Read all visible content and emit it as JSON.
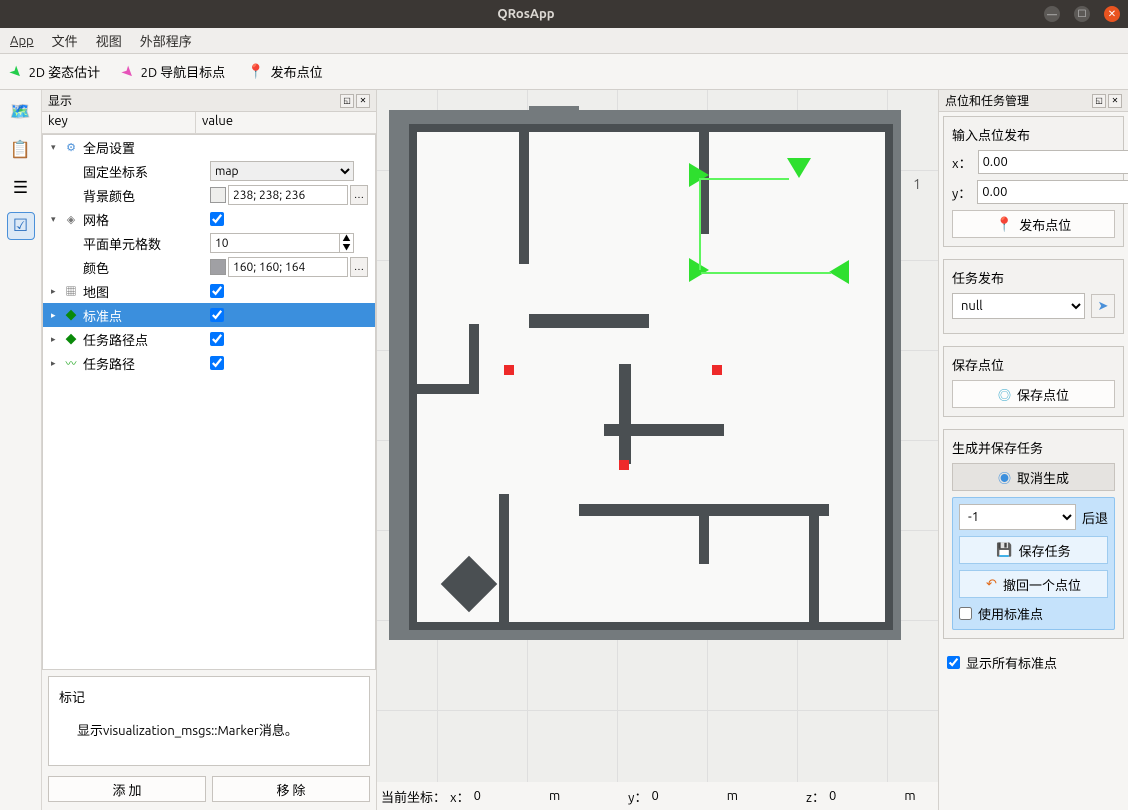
{
  "window": {
    "title": "QRosApp"
  },
  "menu": {
    "app": "App",
    "file": "文件",
    "view": "视图",
    "external": "外部程序"
  },
  "toolbar": {
    "pose_estimate": "2D 姿态估计",
    "nav_goal": "2D 导航目标点",
    "publish_point": "发布点位"
  },
  "display_panel": {
    "title": "显示",
    "header_key": "key",
    "header_value": "value",
    "global_settings": "全局设置",
    "fixed_frame": "固定坐标系",
    "fixed_frame_value": "map",
    "bg_color": "背景颜色",
    "bg_color_value": "238; 238; 236",
    "grid": "网格",
    "plane_cells": "平面单元格数",
    "plane_cells_value": "10",
    "color": "颜色",
    "color_value": "160; 160; 164",
    "map": "地图",
    "marker": "标准点",
    "task_path_points": "任务路径点",
    "task_path": "任务路径",
    "info_title": "标记",
    "info_body": "显示visualization_msgs::Marker消息。",
    "add": "添 加",
    "remove": "移 除"
  },
  "coord_bar": {
    "label": "当前坐标：",
    "x_label": "x：",
    "x_value": "0",
    "y_label": "y：",
    "y_value": "0",
    "z_label": "z：",
    "z_value": "0",
    "unit": "m"
  },
  "right_panel": {
    "title": "点位和任务管理",
    "input_publish": "输入点位发布",
    "x_label": "x：",
    "y_label": "y：",
    "x_value": "0.00",
    "y_value": "0.00",
    "publish_btn": "发布点位",
    "task_publish": "任务发布",
    "task_value": "null",
    "save_point_title": "保存点位",
    "save_point_btn": "保存点位",
    "gen_save_title": "生成并保存任务",
    "cancel_gen": "取消生成",
    "task_index": "-1",
    "back": "后退",
    "save_task": "保存任务",
    "undo_point": "撤回一个点位",
    "use_marker": "使用标准点",
    "show_all_markers": "显示所有标准点"
  }
}
